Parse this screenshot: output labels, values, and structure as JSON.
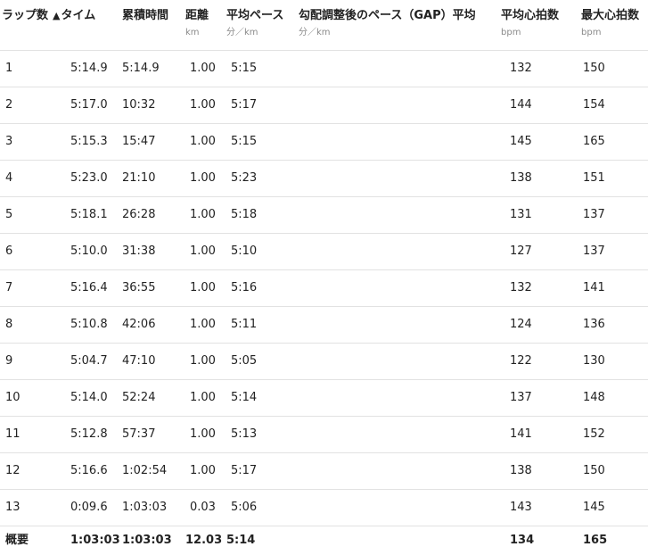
{
  "headers": {
    "lap": "ラップ数",
    "sort_arrow": "▲",
    "time": "タイム",
    "cumulative": "累積時間",
    "distance": "距離",
    "distance_unit": "km",
    "avg_pace": "平均ペース",
    "avg_pace_unit": "分／km",
    "gap": "勾配調整後のペース（GAP）平均",
    "gap_unit": "分／km",
    "avg_hr": "平均心拍数",
    "avg_hr_unit": "bpm",
    "max_hr": "最大心拍数",
    "max_hr_unit": "bpm"
  },
  "laps": [
    {
      "lap": "1",
      "time": "5:14.9",
      "cumulative": "5:14.9",
      "distance": "1.00",
      "pace": "5:15",
      "gap": "",
      "avg_hr": "132",
      "max_hr": "150"
    },
    {
      "lap": "2",
      "time": "5:17.0",
      "cumulative": "10:32",
      "distance": "1.00",
      "pace": "5:17",
      "gap": "",
      "avg_hr": "144",
      "max_hr": "154"
    },
    {
      "lap": "3",
      "time": "5:15.3",
      "cumulative": "15:47",
      "distance": "1.00",
      "pace": "5:15",
      "gap": "",
      "avg_hr": "145",
      "max_hr": "165"
    },
    {
      "lap": "4",
      "time": "5:23.0",
      "cumulative": "21:10",
      "distance": "1.00",
      "pace": "5:23",
      "gap": "",
      "avg_hr": "138",
      "max_hr": "151"
    },
    {
      "lap": "5",
      "time": "5:18.1",
      "cumulative": "26:28",
      "distance": "1.00",
      "pace": "5:18",
      "gap": "",
      "avg_hr": "131",
      "max_hr": "137"
    },
    {
      "lap": "6",
      "time": "5:10.0",
      "cumulative": "31:38",
      "distance": "1.00",
      "pace": "5:10",
      "gap": "",
      "avg_hr": "127",
      "max_hr": "137"
    },
    {
      "lap": "7",
      "time": "5:16.4",
      "cumulative": "36:55",
      "distance": "1.00",
      "pace": "5:16",
      "gap": "",
      "avg_hr": "132",
      "max_hr": "141"
    },
    {
      "lap": "8",
      "time": "5:10.8",
      "cumulative": "42:06",
      "distance": "1.00",
      "pace": "5:11",
      "gap": "",
      "avg_hr": "124",
      "max_hr": "136"
    },
    {
      "lap": "9",
      "time": "5:04.7",
      "cumulative": "47:10",
      "distance": "1.00",
      "pace": "5:05",
      "gap": "",
      "avg_hr": "122",
      "max_hr": "130"
    },
    {
      "lap": "10",
      "time": "5:14.0",
      "cumulative": "52:24",
      "distance": "1.00",
      "pace": "5:14",
      "gap": "",
      "avg_hr": "137",
      "max_hr": "148"
    },
    {
      "lap": "11",
      "time": "5:12.8",
      "cumulative": "57:37",
      "distance": "1.00",
      "pace": "5:13",
      "gap": "",
      "avg_hr": "141",
      "max_hr": "152"
    },
    {
      "lap": "12",
      "time": "5:16.6",
      "cumulative": "1:02:54",
      "distance": "1.00",
      "pace": "5:17",
      "gap": "",
      "avg_hr": "138",
      "max_hr": "150"
    },
    {
      "lap": "13",
      "time": "0:09.6",
      "cumulative": "1:03:03",
      "distance": "0.03",
      "pace": "5:06",
      "gap": "",
      "avg_hr": "143",
      "max_hr": "145"
    }
  ],
  "summary": {
    "label": "概要",
    "time": "1:03:03",
    "cumulative": "1:03:03",
    "distance": "12.03",
    "pace": "5:14",
    "gap": "",
    "avg_hr": "134",
    "max_hr": "165"
  }
}
